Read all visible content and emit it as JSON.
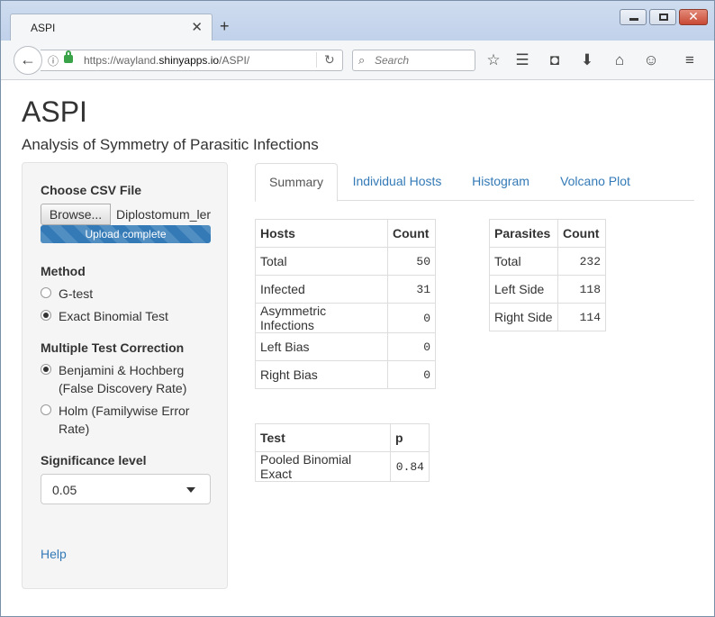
{
  "browser": {
    "tab_title": "ASPI",
    "url_prefix": "https://wayland.",
    "url_host": "shinyapps.io",
    "url_path": "/ASPI/",
    "search_placeholder": "Search"
  },
  "app": {
    "title": "ASPI",
    "subtitle": "Analysis of Symmetry of Parasitic Infections"
  },
  "sidebar": {
    "file_label": "Choose CSV File",
    "browse_label": "Browse...",
    "file_name": "Diplostomum_ler",
    "upload_status": "Upload complete",
    "upload_progress": 1.0,
    "method_label": "Method",
    "method_options": [
      "G-test",
      "Exact Binomial Test"
    ],
    "method_selected": "Exact Binomial Test",
    "correction_label": "Multiple Test Correction",
    "correction_options": [
      "Benjamini & Hochberg",
      "(False Discovery Rate)",
      "Holm (Familywise Error",
      "Rate)"
    ],
    "correction_selected": "Benjamini & Hochberg (False Discovery Rate)",
    "significance_label": "Significance level",
    "significance_value": "0.05",
    "help_label": "Help"
  },
  "tabs": [
    "Summary",
    "Individual Hosts",
    "Histogram",
    "Volcano Plot"
  ],
  "active_tab": "Summary",
  "hosts_table": {
    "headers": [
      "Hosts",
      "Count"
    ],
    "rows": [
      [
        "Total",
        "50"
      ],
      [
        "Infected",
        "31"
      ],
      [
        "Asymmetric Infections",
        "0"
      ],
      [
        "Left Bias",
        "0"
      ],
      [
        "Right Bias",
        "0"
      ]
    ]
  },
  "parasites_table": {
    "headers": [
      "Parasites",
      "Count"
    ],
    "rows": [
      [
        "Total",
        "232"
      ],
      [
        "Left Side",
        "118"
      ],
      [
        "Right Side",
        "114"
      ]
    ]
  },
  "test_table": {
    "headers": [
      "Test",
      "p"
    ],
    "rows": [
      [
        "Pooled Binomial Exact",
        "0.84"
      ]
    ]
  },
  "colors": {
    "link": "#337ab7",
    "sidebar_bg": "#f5f5f5",
    "progress": "#337ab7"
  }
}
